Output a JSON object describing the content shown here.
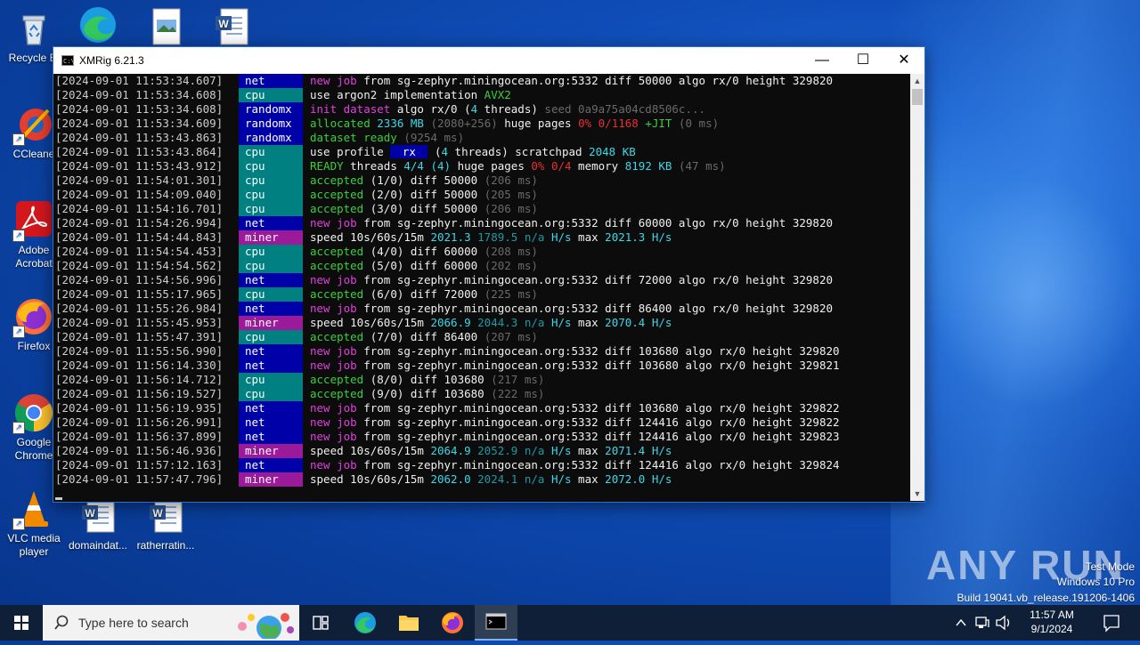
{
  "desktop": {
    "icons": [
      {
        "label": "Recycle Bin",
        "display": "Recycle Bi"
      },
      {
        "label": "CCleaner",
        "display": "CCleane"
      },
      {
        "label": "Adobe Acrobat",
        "display": "Adobe Acrobat"
      },
      {
        "label": "Firefox",
        "display": "Firefox"
      },
      {
        "label": "Google Chrome",
        "display": "Google Chrome"
      },
      {
        "label": "VLC media player",
        "display": "VLC media player"
      },
      {
        "label": "domaindat...",
        "display": "domaindat..."
      },
      {
        "label": "ratherratin...",
        "display": "ratherratin..."
      }
    ]
  },
  "window": {
    "title": "XMRig 6.21.3",
    "minimize": "—",
    "maximize": "☐",
    "close": "✕"
  },
  "console": {
    "lines": [
      {
        "ts": "[2024-09-01 11:53:34.607]",
        "tag": "net",
        "segs": [
          [
            "c-mag",
            "new job"
          ],
          [
            "c-wht",
            " from sg-zephyr.miningocean.org:5332 diff "
          ],
          [
            "c-wht",
            "50000"
          ],
          [
            "c-wht",
            " algo rx/0 height 329820"
          ]
        ]
      },
      {
        "ts": "[2024-09-01 11:53:34.608]",
        "tag": "cpu",
        "segs": [
          [
            "c-wht",
            "use argon2 implementation "
          ],
          [
            "c-grn",
            "AVX2"
          ]
        ]
      },
      {
        "ts": "[2024-09-01 11:53:34.608]",
        "tag": "randomx",
        "segs": [
          [
            "c-mag",
            "init dataset"
          ],
          [
            "c-wht",
            " algo rx/0 ("
          ],
          [
            "c-cyn",
            "4"
          ],
          [
            "c-wht",
            " threads) "
          ],
          [
            "c-gry",
            "seed 0a9a75a04cd8506c..."
          ]
        ]
      },
      {
        "ts": "[2024-09-01 11:53:34.609]",
        "tag": "randomx",
        "segs": [
          [
            "c-grn",
            "allocated "
          ],
          [
            "c-cyn",
            "2336 MB "
          ],
          [
            "c-gry",
            "(2080+256) "
          ],
          [
            "c-wht",
            "huge pages "
          ],
          [
            "c-red",
            "0% 0/1168 "
          ],
          [
            "c-grn",
            "+JIT "
          ],
          [
            "c-gry",
            "(0 ms)"
          ]
        ]
      },
      {
        "ts": "[2024-09-01 11:53:43.863]",
        "tag": "randomx",
        "segs": [
          [
            "c-grn",
            "dataset ready "
          ],
          [
            "c-gry",
            "(9254 ms)"
          ]
        ]
      },
      {
        "ts": "[2024-09-01 11:53:43.864]",
        "tag": "cpu",
        "segs": [
          [
            "c-wht",
            "use profile "
          ],
          [
            "hl-rx",
            " rx "
          ],
          [
            "c-wht",
            " ("
          ],
          [
            "c-cyn",
            "4"
          ],
          [
            "c-wht",
            " threads) scratchpad "
          ],
          [
            "c-cyn",
            "2048 KB"
          ]
        ]
      },
      {
        "ts": "[2024-09-01 11:53:43.912]",
        "tag": "cpu",
        "segs": [
          [
            "c-grn",
            "READY"
          ],
          [
            "c-wht",
            " threads "
          ],
          [
            "c-cyn",
            "4/4 (4)"
          ],
          [
            "c-wht",
            " huge pages "
          ],
          [
            "c-red",
            "0% 0/4"
          ],
          [
            "c-wht",
            " memory "
          ],
          [
            "c-cyn",
            "8192 KB "
          ],
          [
            "c-gry",
            "(47 ms)"
          ]
        ]
      },
      {
        "ts": "[2024-09-01 11:54:01.301]",
        "tag": "cpu",
        "segs": [
          [
            "c-grn",
            "accepted"
          ],
          [
            "c-wht",
            " (1/0) diff 50000 "
          ],
          [
            "c-gry",
            "(206 ms)"
          ]
        ]
      },
      {
        "ts": "[2024-09-01 11:54:09.040]",
        "tag": "cpu",
        "segs": [
          [
            "c-grn",
            "accepted"
          ],
          [
            "c-wht",
            " (2/0) diff 50000 "
          ],
          [
            "c-gry",
            "(205 ms)"
          ]
        ]
      },
      {
        "ts": "[2024-09-01 11:54:16.701]",
        "tag": "cpu",
        "segs": [
          [
            "c-grn",
            "accepted"
          ],
          [
            "c-wht",
            " (3/0) diff 50000 "
          ],
          [
            "c-gry",
            "(206 ms)"
          ]
        ]
      },
      {
        "ts": "[2024-09-01 11:54:26.994]",
        "tag": "net",
        "segs": [
          [
            "c-mag",
            "new job"
          ],
          [
            "c-wht",
            " from sg-zephyr.miningocean.org:5332 diff 60000 algo rx/0 height 329820"
          ]
        ]
      },
      {
        "ts": "[2024-09-01 11:54:44.843]",
        "tag": "miner",
        "segs": [
          [
            "c-wht",
            "speed 10s/60s/15m "
          ],
          [
            "c-cyn",
            "2021.3 "
          ],
          [
            "c-tcy",
            "1789.5 n/a "
          ],
          [
            "c-cyn",
            "H/s"
          ],
          [
            "c-wht",
            " max "
          ],
          [
            "c-cyn",
            "2021.3 H/s"
          ]
        ]
      },
      {
        "ts": "[2024-09-01 11:54:54.453]",
        "tag": "cpu",
        "segs": [
          [
            "c-grn",
            "accepted"
          ],
          [
            "c-wht",
            " (4/0) diff 60000 "
          ],
          [
            "c-gry",
            "(208 ms)"
          ]
        ]
      },
      {
        "ts": "[2024-09-01 11:54:54.562]",
        "tag": "cpu",
        "segs": [
          [
            "c-grn",
            "accepted"
          ],
          [
            "c-wht",
            " (5/0) diff 60000 "
          ],
          [
            "c-gry",
            "(202 ms)"
          ]
        ]
      },
      {
        "ts": "[2024-09-01 11:54:56.996]",
        "tag": "net",
        "segs": [
          [
            "c-mag",
            "new job"
          ],
          [
            "c-wht",
            " from sg-zephyr.miningocean.org:5332 diff 72000 algo rx/0 height 329820"
          ]
        ]
      },
      {
        "ts": "[2024-09-01 11:55:17.965]",
        "tag": "cpu",
        "segs": [
          [
            "c-grn",
            "accepted"
          ],
          [
            "c-wht",
            " (6/0) diff 72000 "
          ],
          [
            "c-gry",
            "(225 ms)"
          ]
        ]
      },
      {
        "ts": "[2024-09-01 11:55:26.984]",
        "tag": "net",
        "segs": [
          [
            "c-mag",
            "new job"
          ],
          [
            "c-wht",
            " from sg-zephyr.miningocean.org:5332 diff 86400 algo rx/0 height 329820"
          ]
        ]
      },
      {
        "ts": "[2024-09-01 11:55:45.953]",
        "tag": "miner",
        "segs": [
          [
            "c-wht",
            "speed 10s/60s/15m "
          ],
          [
            "c-cyn",
            "2066.9 "
          ],
          [
            "c-tcy",
            "2044.3 n/a "
          ],
          [
            "c-cyn",
            "H/s"
          ],
          [
            "c-wht",
            " max "
          ],
          [
            "c-cyn",
            "2070.4 H/s"
          ]
        ]
      },
      {
        "ts": "[2024-09-01 11:55:47.391]",
        "tag": "cpu",
        "segs": [
          [
            "c-grn",
            "accepted"
          ],
          [
            "c-wht",
            " (7/0) diff 86400 "
          ],
          [
            "c-gry",
            "(207 ms)"
          ]
        ]
      },
      {
        "ts": "[2024-09-01 11:55:56.990]",
        "tag": "net",
        "segs": [
          [
            "c-mag",
            "new job"
          ],
          [
            "c-wht",
            " from sg-zephyr.miningocean.org:5332 diff 103680 algo rx/0 height 329820"
          ]
        ]
      },
      {
        "ts": "[2024-09-01 11:56:14.330]",
        "tag": "net",
        "segs": [
          [
            "c-mag",
            "new job"
          ],
          [
            "c-wht",
            " from sg-zephyr.miningocean.org:5332 diff 103680 algo rx/0 height 329821"
          ]
        ]
      },
      {
        "ts": "[2024-09-01 11:56:14.712]",
        "tag": "cpu",
        "segs": [
          [
            "c-grn",
            "accepted"
          ],
          [
            "c-wht",
            " (8/0) diff 103680 "
          ],
          [
            "c-gry",
            "(217 ms)"
          ]
        ]
      },
      {
        "ts": "[2024-09-01 11:56:19.527]",
        "tag": "cpu",
        "segs": [
          [
            "c-grn",
            "accepted"
          ],
          [
            "c-wht",
            " (9/0) diff 103680 "
          ],
          [
            "c-gry",
            "(222 ms)"
          ]
        ]
      },
      {
        "ts": "[2024-09-01 11:56:19.935]",
        "tag": "net",
        "segs": [
          [
            "c-mag",
            "new job"
          ],
          [
            "c-wht",
            " from sg-zephyr.miningocean.org:5332 diff 103680 algo rx/0 height 329822"
          ]
        ]
      },
      {
        "ts": "[2024-09-01 11:56:26.991]",
        "tag": "net",
        "segs": [
          [
            "c-mag",
            "new job"
          ],
          [
            "c-wht",
            " from sg-zephyr.miningocean.org:5332 diff 124416 algo rx/0 height 329822"
          ]
        ]
      },
      {
        "ts": "[2024-09-01 11:56:37.899]",
        "tag": "net",
        "segs": [
          [
            "c-mag",
            "new job"
          ],
          [
            "c-wht",
            " from sg-zephyr.miningocean.org:5332 diff 124416 algo rx/0 height 329823"
          ]
        ]
      },
      {
        "ts": "[2024-09-01 11:56:46.936]",
        "tag": "miner",
        "segs": [
          [
            "c-wht",
            "speed 10s/60s/15m "
          ],
          [
            "c-cyn",
            "2064.9 "
          ],
          [
            "c-tcy",
            "2052.9 n/a "
          ],
          [
            "c-cyn",
            "H/s"
          ],
          [
            "c-wht",
            " max "
          ],
          [
            "c-cyn",
            "2071.4 H/s"
          ]
        ]
      },
      {
        "ts": "[2024-09-01 11:57:12.163]",
        "tag": "net",
        "segs": [
          [
            "c-mag",
            "new job"
          ],
          [
            "c-wht",
            " from sg-zephyr.miningocean.org:5332 diff 124416 algo rx/0 height 329824"
          ]
        ]
      },
      {
        "ts": "[2024-09-01 11:57:47.796]",
        "tag": "miner",
        "segs": [
          [
            "c-wht",
            "speed 10s/60s/15m "
          ],
          [
            "c-cyn",
            "2062.0 "
          ],
          [
            "c-tcy",
            "2024.1 n/a "
          ],
          [
            "c-cyn",
            "H/s"
          ],
          [
            "c-wht",
            " max "
          ],
          [
            "c-cyn",
            "2072.0 H/s"
          ]
        ]
      }
    ]
  },
  "watermark": {
    "logo": "ANY RUN",
    "test_mode": "Test Mode",
    "edition": "Windows 10 Pro",
    "build": "Build 19041.vb_release.191206-1406"
  },
  "taskbar": {
    "search_placeholder": "Type here to search",
    "clock_time": "11:57 AM",
    "clock_date": "9/1/2024"
  },
  "colors": {
    "net_tag": "#0000a8",
    "cpu_tag": "#008080",
    "miner_tag": "#9a1a9a",
    "taskbar": "#0f1f38"
  }
}
